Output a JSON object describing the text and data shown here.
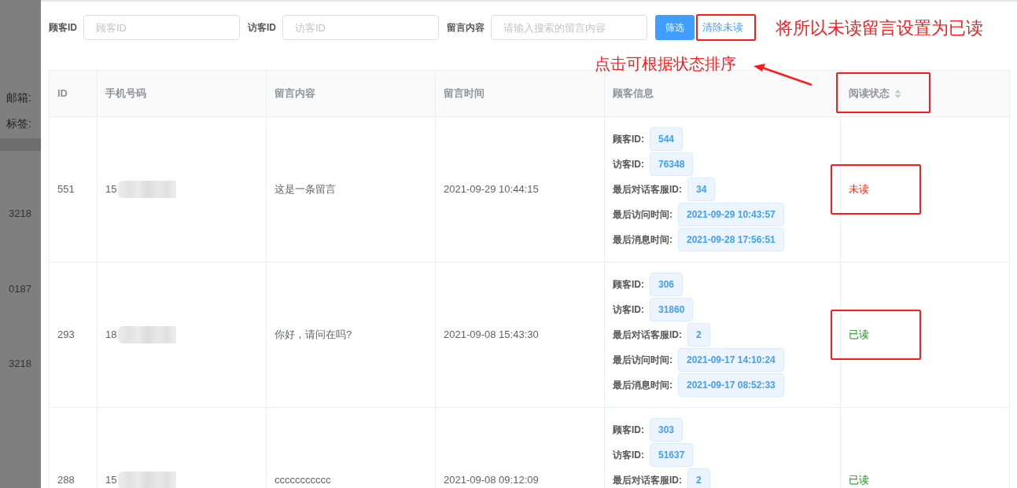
{
  "background_fragments": [
    {
      "kind": "label",
      "text": "邮箱:"
    },
    {
      "kind": "label",
      "text": "标签:"
    },
    {
      "kind": "number",
      "text": "3218"
    },
    {
      "kind": "number",
      "text": "0187"
    },
    {
      "kind": "number",
      "text": "3218"
    }
  ],
  "filters": [
    {
      "label": "顾客ID",
      "placeholder": "顾客ID"
    },
    {
      "label": "访客ID",
      "placeholder": "访客ID"
    },
    {
      "label": "留言内容",
      "placeholder": "请输入搜索的留言内容"
    }
  ],
  "buttons": [
    {
      "label": "筛选",
      "kind": "primary",
      "highlighted": false
    },
    {
      "label": "清除未读",
      "kind": "text",
      "highlighted": true
    }
  ],
  "annotations": [
    {
      "kind": "note",
      "text": "将所以未读留言设置为已读"
    },
    {
      "kind": "arrow-note",
      "text": "点击可根据状态排序"
    }
  ],
  "table": {
    "columns": [
      {
        "label": "ID",
        "sortable": false,
        "highlighted": false
      },
      {
        "label": "手机号码",
        "sortable": false,
        "highlighted": false
      },
      {
        "label": "留言内容",
        "sortable": false,
        "highlighted": false
      },
      {
        "label": "留言时间",
        "sortable": false,
        "highlighted": false
      },
      {
        "label": "顾客信息",
        "sortable": false,
        "highlighted": false
      },
      {
        "label": "阅读状态",
        "sortable": true,
        "highlighted": true
      }
    ],
    "rows": [
      {
        "id": "551",
        "phone": "15",
        "content": "这是一条留言",
        "time": "2021-09-29 10:44:15",
        "info": [
          {
            "label": "顾客ID:",
            "value": "544"
          },
          {
            "label": "访客ID:",
            "value": "76348"
          },
          {
            "label": "最后对话客服ID:",
            "value": "34"
          },
          {
            "label": "最后访问时间:",
            "value": "2021-09-29 10:43:57"
          },
          {
            "label": "最后消息时间:",
            "value": "2021-09-28 17:56:51"
          }
        ],
        "status": "未读",
        "read": false,
        "highlighted": true
      },
      {
        "id": "293",
        "phone": "18",
        "content": "你好，请问在吗?",
        "time": "2021-09-08 15:43:30",
        "info": [
          {
            "label": "顾客ID:",
            "value": "306"
          },
          {
            "label": "访客ID:",
            "value": "31860"
          },
          {
            "label": "最后对话客服ID:",
            "value": "2"
          },
          {
            "label": "最后访问时间:",
            "value": "2021-09-17 14:10:24"
          },
          {
            "label": "最后消息时间:",
            "value": "2021-09-17 08:52:33"
          }
        ],
        "status": "已读",
        "read": true,
        "highlighted": true
      },
      {
        "id": "288",
        "phone": "15",
        "content": "ccccccccccc",
        "time": "2021-09-08 09:12:09",
        "info": [
          {
            "label": "顾客ID:",
            "value": "303"
          },
          {
            "label": "访客ID:",
            "value": "51637"
          },
          {
            "label": "最后对话客服ID:",
            "value": "2"
          }
        ],
        "status": "已读",
        "read": true,
        "highlighted": false
      }
    ]
  }
}
